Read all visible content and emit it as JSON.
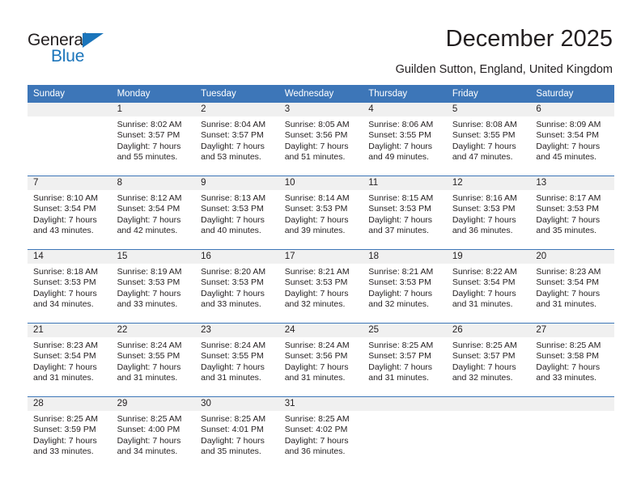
{
  "brand": {
    "name_part1": "General",
    "name_part2": "Blue",
    "triangle_icon": "triangle-icon",
    "colors": {
      "dark": "#231f20",
      "blue": "#1b75bb"
    }
  },
  "header": {
    "title": "December 2025",
    "subtitle": "Guilden Sutton, England, United Kingdom"
  },
  "colors": {
    "header_blue": "#3d76b8",
    "daynum_band": "#f0f0f0",
    "text": "#231f20"
  },
  "calendar": {
    "weekday_headers": [
      "Sunday",
      "Monday",
      "Tuesday",
      "Wednesday",
      "Thursday",
      "Friday",
      "Saturday"
    ],
    "weeks": [
      [
        {
          "day": "",
          "empty": true
        },
        {
          "day": "1",
          "sunrise": "Sunrise: 8:02 AM",
          "sunset": "Sunset: 3:57 PM",
          "daylight": "Daylight: 7 hours and 55 minutes."
        },
        {
          "day": "2",
          "sunrise": "Sunrise: 8:04 AM",
          "sunset": "Sunset: 3:57 PM",
          "daylight": "Daylight: 7 hours and 53 minutes."
        },
        {
          "day": "3",
          "sunrise": "Sunrise: 8:05 AM",
          "sunset": "Sunset: 3:56 PM",
          "daylight": "Daylight: 7 hours and 51 minutes."
        },
        {
          "day": "4",
          "sunrise": "Sunrise: 8:06 AM",
          "sunset": "Sunset: 3:55 PM",
          "daylight": "Daylight: 7 hours and 49 minutes."
        },
        {
          "day": "5",
          "sunrise": "Sunrise: 8:08 AM",
          "sunset": "Sunset: 3:55 PM",
          "daylight": "Daylight: 7 hours and 47 minutes."
        },
        {
          "day": "6",
          "sunrise": "Sunrise: 8:09 AM",
          "sunset": "Sunset: 3:54 PM",
          "daylight": "Daylight: 7 hours and 45 minutes."
        }
      ],
      [
        {
          "day": "7",
          "sunrise": "Sunrise: 8:10 AM",
          "sunset": "Sunset: 3:54 PM",
          "daylight": "Daylight: 7 hours and 43 minutes."
        },
        {
          "day": "8",
          "sunrise": "Sunrise: 8:12 AM",
          "sunset": "Sunset: 3:54 PM",
          "daylight": "Daylight: 7 hours and 42 minutes."
        },
        {
          "day": "9",
          "sunrise": "Sunrise: 8:13 AM",
          "sunset": "Sunset: 3:53 PM",
          "daylight": "Daylight: 7 hours and 40 minutes."
        },
        {
          "day": "10",
          "sunrise": "Sunrise: 8:14 AM",
          "sunset": "Sunset: 3:53 PM",
          "daylight": "Daylight: 7 hours and 39 minutes."
        },
        {
          "day": "11",
          "sunrise": "Sunrise: 8:15 AM",
          "sunset": "Sunset: 3:53 PM",
          "daylight": "Daylight: 7 hours and 37 minutes."
        },
        {
          "day": "12",
          "sunrise": "Sunrise: 8:16 AM",
          "sunset": "Sunset: 3:53 PM",
          "daylight": "Daylight: 7 hours and 36 minutes."
        },
        {
          "day": "13",
          "sunrise": "Sunrise: 8:17 AM",
          "sunset": "Sunset: 3:53 PM",
          "daylight": "Daylight: 7 hours and 35 minutes."
        }
      ],
      [
        {
          "day": "14",
          "sunrise": "Sunrise: 8:18 AM",
          "sunset": "Sunset: 3:53 PM",
          "daylight": "Daylight: 7 hours and 34 minutes."
        },
        {
          "day": "15",
          "sunrise": "Sunrise: 8:19 AM",
          "sunset": "Sunset: 3:53 PM",
          "daylight": "Daylight: 7 hours and 33 minutes."
        },
        {
          "day": "16",
          "sunrise": "Sunrise: 8:20 AM",
          "sunset": "Sunset: 3:53 PM",
          "daylight": "Daylight: 7 hours and 33 minutes."
        },
        {
          "day": "17",
          "sunrise": "Sunrise: 8:21 AM",
          "sunset": "Sunset: 3:53 PM",
          "daylight": "Daylight: 7 hours and 32 minutes."
        },
        {
          "day": "18",
          "sunrise": "Sunrise: 8:21 AM",
          "sunset": "Sunset: 3:53 PM",
          "daylight": "Daylight: 7 hours and 32 minutes."
        },
        {
          "day": "19",
          "sunrise": "Sunrise: 8:22 AM",
          "sunset": "Sunset: 3:54 PM",
          "daylight": "Daylight: 7 hours and 31 minutes."
        },
        {
          "day": "20",
          "sunrise": "Sunrise: 8:23 AM",
          "sunset": "Sunset: 3:54 PM",
          "daylight": "Daylight: 7 hours and 31 minutes."
        }
      ],
      [
        {
          "day": "21",
          "sunrise": "Sunrise: 8:23 AM",
          "sunset": "Sunset: 3:54 PM",
          "daylight": "Daylight: 7 hours and 31 minutes."
        },
        {
          "day": "22",
          "sunrise": "Sunrise: 8:24 AM",
          "sunset": "Sunset: 3:55 PM",
          "daylight": "Daylight: 7 hours and 31 minutes."
        },
        {
          "day": "23",
          "sunrise": "Sunrise: 8:24 AM",
          "sunset": "Sunset: 3:55 PM",
          "daylight": "Daylight: 7 hours and 31 minutes."
        },
        {
          "day": "24",
          "sunrise": "Sunrise: 8:24 AM",
          "sunset": "Sunset: 3:56 PM",
          "daylight": "Daylight: 7 hours and 31 minutes."
        },
        {
          "day": "25",
          "sunrise": "Sunrise: 8:25 AM",
          "sunset": "Sunset: 3:57 PM",
          "daylight": "Daylight: 7 hours and 31 minutes."
        },
        {
          "day": "26",
          "sunrise": "Sunrise: 8:25 AM",
          "sunset": "Sunset: 3:57 PM",
          "daylight": "Daylight: 7 hours and 32 minutes."
        },
        {
          "day": "27",
          "sunrise": "Sunrise: 8:25 AM",
          "sunset": "Sunset: 3:58 PM",
          "daylight": "Daylight: 7 hours and 33 minutes."
        }
      ],
      [
        {
          "day": "28",
          "sunrise": "Sunrise: 8:25 AM",
          "sunset": "Sunset: 3:59 PM",
          "daylight": "Daylight: 7 hours and 33 minutes."
        },
        {
          "day": "29",
          "sunrise": "Sunrise: 8:25 AM",
          "sunset": "Sunset: 4:00 PM",
          "daylight": "Daylight: 7 hours and 34 minutes."
        },
        {
          "day": "30",
          "sunrise": "Sunrise: 8:25 AM",
          "sunset": "Sunset: 4:01 PM",
          "daylight": "Daylight: 7 hours and 35 minutes."
        },
        {
          "day": "31",
          "sunrise": "Sunrise: 8:25 AM",
          "sunset": "Sunset: 4:02 PM",
          "daylight": "Daylight: 7 hours and 36 minutes."
        },
        {
          "day": "",
          "empty": true
        },
        {
          "day": "",
          "empty": true
        },
        {
          "day": "",
          "empty": true
        }
      ]
    ]
  }
}
